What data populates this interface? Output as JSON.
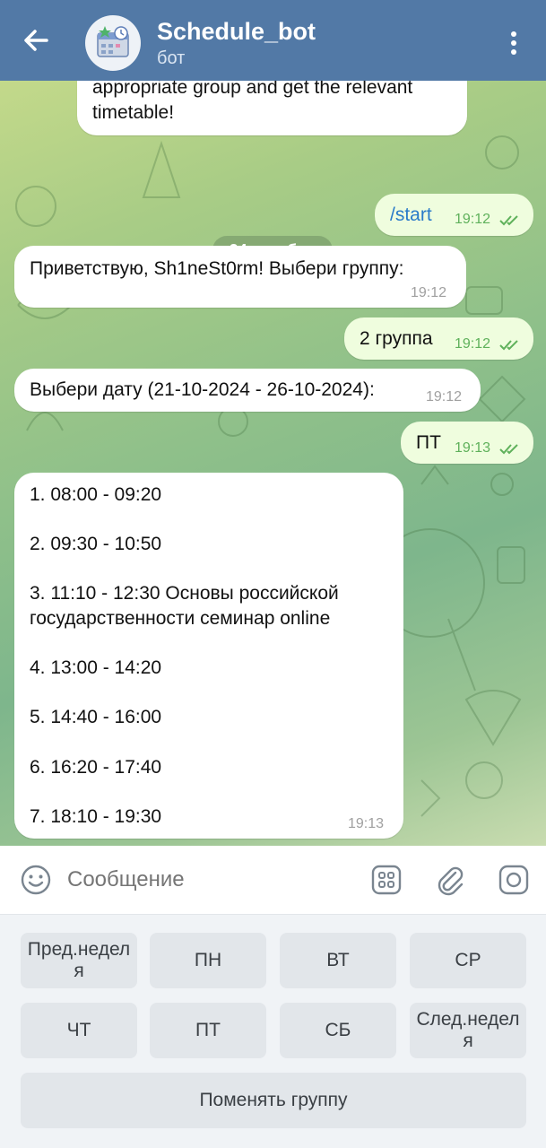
{
  "header": {
    "title": "Schedule_bot",
    "subtitle": "бот"
  },
  "messages": [
    {
      "side": "in",
      "text": "appropriate group and get the relevant\ntimetable!",
      "time": ""
    },
    {
      "side": "out",
      "text": "/start",
      "time": "19:12"
    },
    {
      "side": "in",
      "text": "Приветствую, Sh1neSt0rm! Выбери группу:",
      "time": "19:12"
    },
    {
      "side": "out",
      "text": "2 группа",
      "time": "19:12"
    },
    {
      "side": "in",
      "text": "Выбери дату (21-10-2024 - 26-10-2024):",
      "time": "19:12"
    },
    {
      "side": "out",
      "text": "ПТ",
      "time": "19:13"
    },
    {
      "side": "in",
      "text": "1. 08:00 - 09:20\n\n2. 09:30 - 10:50\n\n3. 11:10 - 12:30 Основы российской\nгосударственности семинар online\n\n4. 13:00 - 14:20\n\n5. 14:40 - 16:00\n\n6. 16:20 - 17:40\n\n7. 18:10 - 19:30",
      "time": "19:13"
    }
  ],
  "date_chip": "24 октября",
  "input": {
    "placeholder": "Сообщение"
  },
  "keyboard": {
    "row1": [
      "Пред.неделя",
      "ПН",
      "ВТ",
      "СР"
    ],
    "row2": [
      "ЧТ",
      "ПТ",
      "СБ",
      "След.неделя"
    ],
    "row3": [
      "Поменять группу"
    ]
  },
  "colors": {
    "header": "#5279a6",
    "outgoing_bubble": "#effdde",
    "incoming_bubble": "#ffffff",
    "link": "#2a7bc9"
  },
  "icons": {
    "back": "arrow-left-icon",
    "menu": "more-vert-icon",
    "emoji": "smile-icon",
    "keyboard": "bot-keyboard-icon",
    "attach": "paperclip-icon",
    "camera": "camera-icon"
  }
}
